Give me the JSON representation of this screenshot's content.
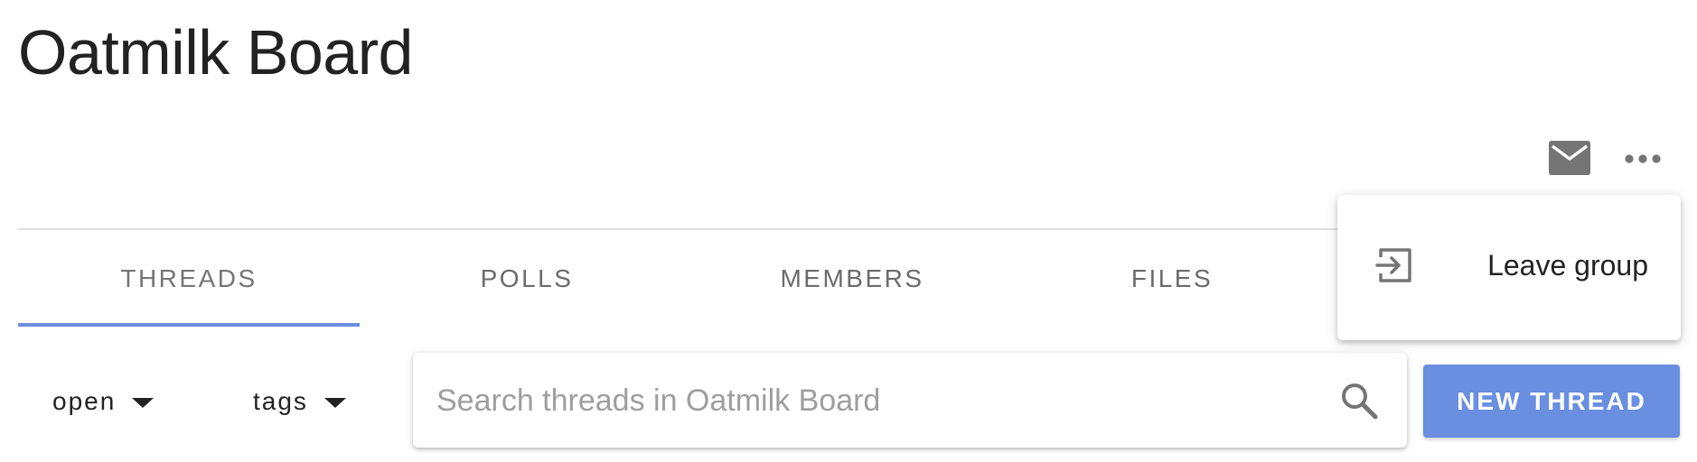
{
  "page": {
    "title": "Oatmilk Board"
  },
  "header_actions": {
    "mail_icon": "mail-icon",
    "more_icon": "more-horizontal-icon"
  },
  "tabs": [
    {
      "label": "THREADS",
      "active": true
    },
    {
      "label": "POLLS",
      "active": false
    },
    {
      "label": "MEMBERS",
      "active": false
    },
    {
      "label": "FILES",
      "active": false
    }
  ],
  "filters": {
    "status": {
      "label": "open",
      "icon": "caret-down-icon"
    },
    "tags": {
      "label": "tags",
      "icon": "caret-down-icon"
    }
  },
  "search": {
    "placeholder": "Search threads in Oatmilk Board",
    "value": "",
    "icon": "search-icon"
  },
  "actions": {
    "new_thread_label": "NEW THREAD"
  },
  "overflow_menu": {
    "items": [
      {
        "label": "Leave group",
        "icon": "leave-group-icon"
      }
    ]
  },
  "colors": {
    "accent": "#6a8fe0",
    "tab_text": "#6b6b6b",
    "icon_gray": "#757575"
  }
}
